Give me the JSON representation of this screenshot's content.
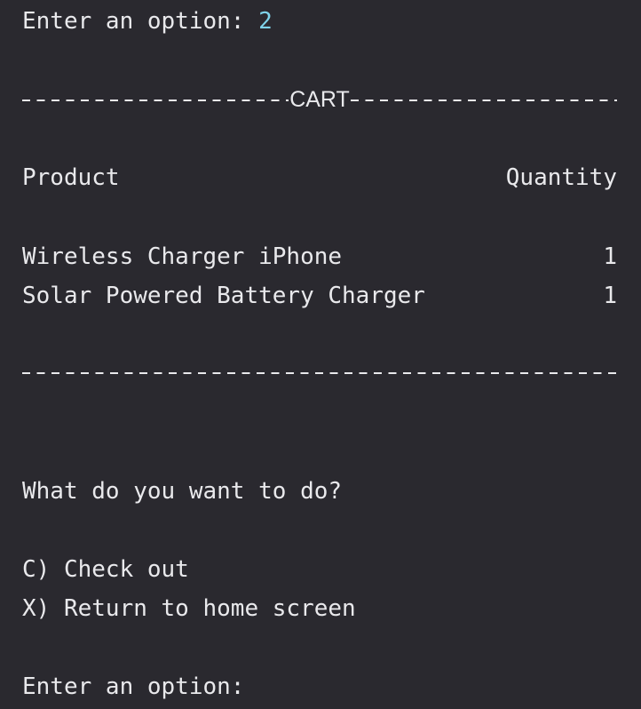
{
  "prompt1": {
    "label": "Enter an option: ",
    "value": "2"
  },
  "cart": {
    "title": "CART",
    "columns": {
      "product": "Product",
      "quantity": "Quantity"
    },
    "items": [
      {
        "product": "Wireless Charger iPhone",
        "quantity": "1"
      },
      {
        "product": "Solar Powered Battery Charger",
        "quantity": "1"
      }
    ]
  },
  "menu": {
    "question": "What do you want to do?",
    "options": [
      {
        "label": "C) Check out"
      },
      {
        "label": "X) Return to home screen"
      }
    ]
  },
  "prompt2": {
    "label": "Enter an option:"
  },
  "colors": {
    "background": "#2a292f",
    "text": "#e9e9ec",
    "input": "#7fd3ea"
  }
}
